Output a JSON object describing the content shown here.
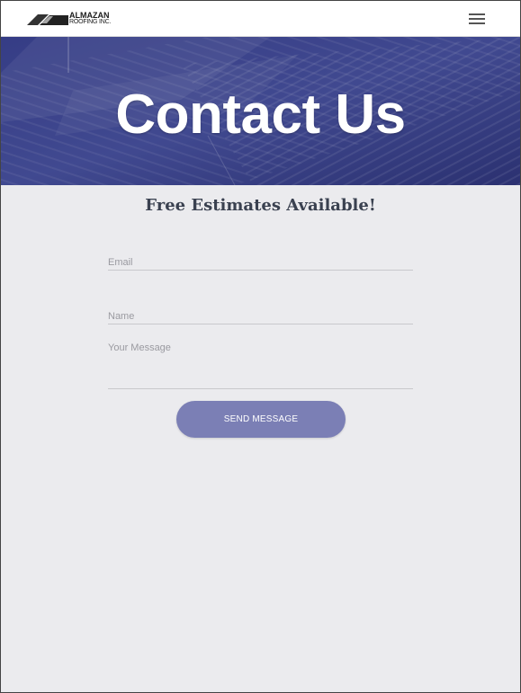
{
  "header": {
    "logo_line1": "ALMAZAN",
    "logo_line2": "ROOFING INC.",
    "menu_icon": "hamburger-menu-icon"
  },
  "hero": {
    "title": "Contact Us",
    "overlay_color": "#2e3573"
  },
  "form": {
    "subtitle": "Free Estimates Available!",
    "email_placeholder": "Email",
    "name_placeholder": "Name",
    "message_placeholder": "Your Message",
    "submit_label": "SEND MESSAGE",
    "submit_color": "#7b7fb5"
  }
}
